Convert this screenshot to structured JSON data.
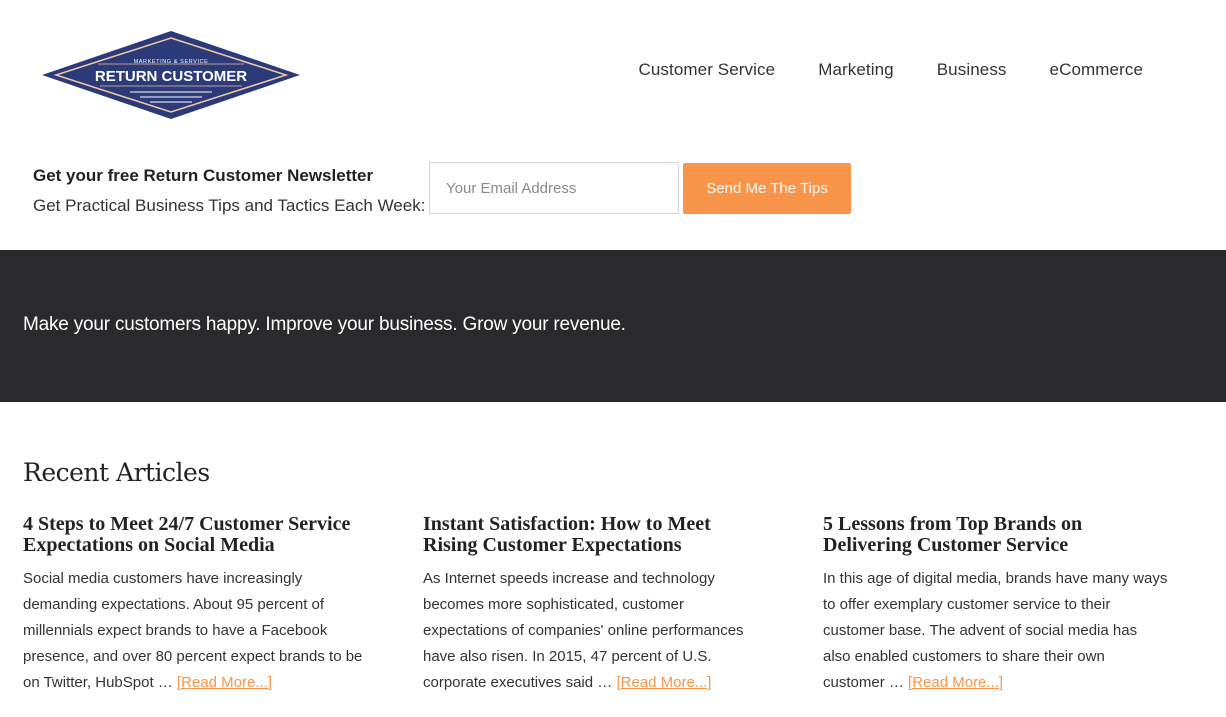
{
  "brand": {
    "logo_tagline": "MARKETING & SERVICE",
    "logo_name": "RETURN CUSTOMER",
    "colors": {
      "navy": "#2b3a78",
      "accent": "#f9954a",
      "banner": "#2a2a2d"
    }
  },
  "nav": {
    "items": [
      {
        "label": "Customer Service"
      },
      {
        "label": "Marketing"
      },
      {
        "label": "Business"
      },
      {
        "label": "eCommerce"
      }
    ]
  },
  "newsletter": {
    "title": "Get your free Return Customer Newsletter",
    "subtitle": "Get Practical Business Tips and Tactics Each Week:",
    "email_placeholder": "Your Email Address",
    "email_value": "",
    "button_label": "Send Me The Tips"
  },
  "banner": {
    "text": "Make your customers happy. Improve your business. Grow your revenue."
  },
  "recent": {
    "heading": "Recent Articles",
    "read_more_label": "[Read More...]",
    "articles": [
      {
        "title": "4 Steps to Meet 24/7 Customer Service Expectations on Social Media",
        "excerpt": "Social media customers have increasingly demanding expectations. About 95 percent of millennials expect brands to have a Facebook presence, and over 80 percent expect brands to be on Twitter, HubSpot …"
      },
      {
        "title": "Instant Satisfaction: How to Meet Rising Customer Expectations",
        "excerpt": "As Internet speeds increase and technology becomes more sophisticated, customer expectations of companies' online performances have also risen. In 2015, 47 percent of U.S. corporate executives said …"
      },
      {
        "title": "5 Lessons from Top Brands on Delivering Customer Service",
        "excerpt": "In this age of digital media, brands have many ways to offer exemplary customer service to their customer base. The advent of social media has also enabled customers to share their own customer …"
      }
    ]
  }
}
